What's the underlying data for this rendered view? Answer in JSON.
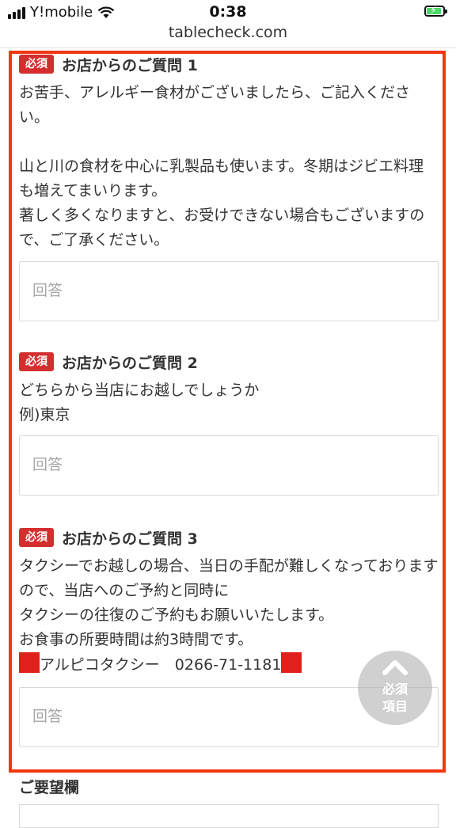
{
  "status_bar": {
    "carrier": "Y!mobile",
    "time": "0:38",
    "url": "tablecheck.com"
  },
  "required_badge": "必須",
  "questions": [
    {
      "title": "お店からのご質問 1",
      "body": "お苦手、アレルギー食材がございましたら、ご記入ください。\n\n山と川の食材を中心に乳製品も使います。冬期はジビエ料理も増えてまいります。\n著しく多くなりますと、お受けできない場合もございますので、ご了承ください。",
      "placeholder": "回答"
    },
    {
      "title": "お店からのご質問 2",
      "body": "どちらから当店にお越しでしょうか\n例)東京",
      "placeholder": "回答"
    },
    {
      "title": "お店からのご質問 3",
      "body": "タクシーでお越しの場合、当日の手配が難しくなっておりますので、当店へのご予約と同時に\nタクシーの往復のご予約もお願いいたします。\nお食事の所要時間は約3時間です。",
      "line_taxi": "アルピコタクシー　0266-71-1181",
      "placeholder": "回答"
    }
  ],
  "float_button": {
    "line1": "必須",
    "line2": "項目"
  },
  "requests_section_title": "ご要望欄",
  "colors": {
    "badge": "#d32f2f",
    "highlight": "#f2380f",
    "red_square": "#e0201a"
  }
}
